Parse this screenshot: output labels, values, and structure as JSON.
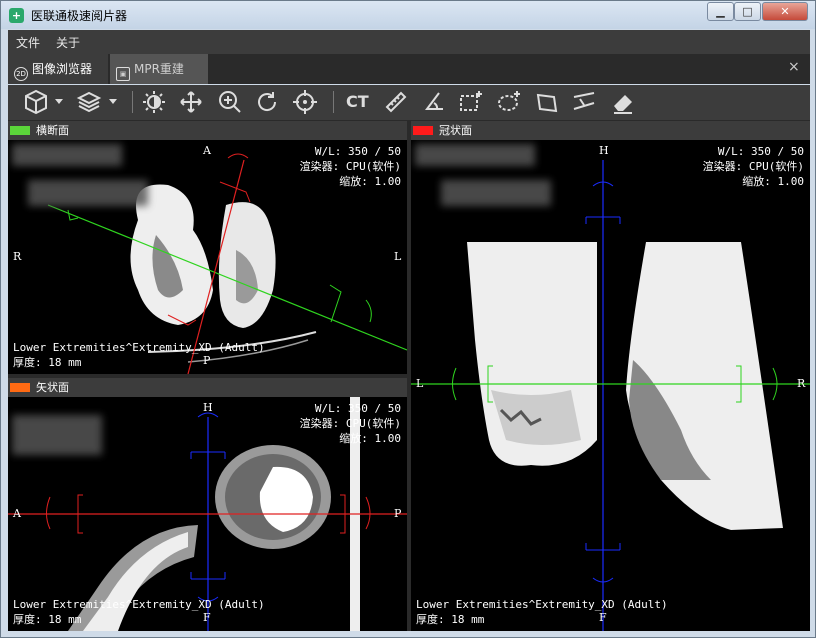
{
  "window": {
    "title": "医联通极速阅片器",
    "minimize": "▁",
    "maximize": "□",
    "close": "✕"
  },
  "menu": [
    "文件",
    "关于"
  ],
  "tabs": [
    {
      "label": "图像浏览器",
      "icon": "2D",
      "active": true
    },
    {
      "label": "MPR重建",
      "icon": "cube",
      "active": false
    }
  ],
  "tab_close": "×",
  "toolbar": {
    "ct_label": "CT",
    "tools": [
      "layout-cube-icon",
      "series-icon",
      "contrast-icon",
      "pan-icon",
      "zoom-icon",
      "rotate-icon",
      "crosshair-icon",
      "ct-preset",
      "ruler-icon",
      "angle-icon",
      "roi-rect-icon",
      "roi-ellipse-icon",
      "roi-polygon-icon",
      "roi-cobb-icon",
      "eraser-icon"
    ]
  },
  "views": {
    "axial": {
      "title": "横断面",
      "color": "#5bd43a",
      "wl": "W/L: 350 / 50",
      "renderer": "渲染器: CPU(软件)",
      "zoom": "缩放: 1.00",
      "protocol": "Lower Extremities^Extremity_XD (Adult)",
      "thickness": "厚度: 18 mm",
      "top": "A",
      "bottom": "P",
      "left": "R",
      "right": "L"
    },
    "sagittal": {
      "title": "矢状面",
      "color": "#ff6a13",
      "wl": "W/L: 350 / 50",
      "renderer": "渲染器: CPU(软件)",
      "zoom": "缩放: 1.00",
      "protocol": "Lower Extremities^Extremity_XD (Adult)",
      "thickness": "厚度: 18 mm",
      "top": "H",
      "bottom": "F",
      "left": "A",
      "right": "P"
    },
    "coronal": {
      "title": "冠状面",
      "color": "#ff1b1b",
      "wl": "W/L: 350 / 50",
      "renderer": "渲染器: CPU(软件)",
      "zoom": "缩放: 1.00",
      "protocol": "Lower Extremities^Extremity_XD (Adult)",
      "thickness": "厚度: 18 mm",
      "top": "H",
      "bottom": "F",
      "left": "L",
      "right": "R"
    }
  }
}
